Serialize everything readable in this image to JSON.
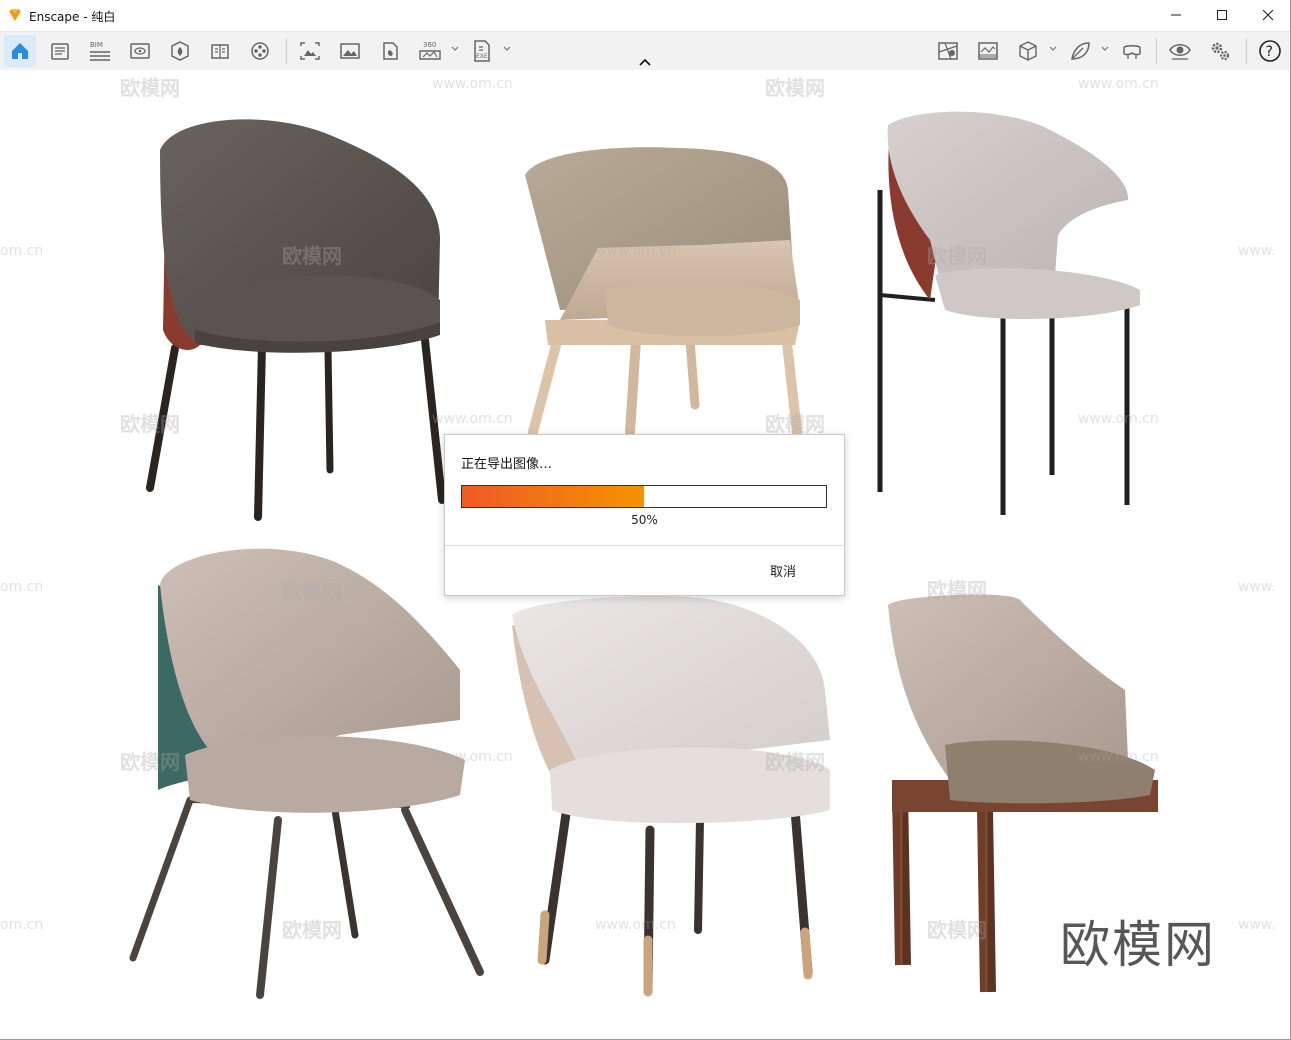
{
  "window": {
    "title": "Enscape - 纯白",
    "controls": [
      "minimize",
      "maximize",
      "close"
    ]
  },
  "toolbar": {
    "left_buttons": [
      {
        "icon": "home-icon",
        "active": true
      },
      {
        "icon": "document-icon"
      },
      {
        "icon": "bim-icon",
        "label": "BIM"
      },
      {
        "icon": "eye-view-icon"
      },
      {
        "icon": "asset-library-icon"
      },
      {
        "icon": "book-icon"
      },
      {
        "icon": "film-reel-icon"
      },
      {
        "icon": "screenshot-icon"
      },
      {
        "icon": "image-icon"
      },
      {
        "icon": "panorama-icon"
      },
      {
        "icon": "360-export-icon",
        "label": "360"
      },
      {
        "icon": "exe-export-icon",
        "label": "EXE"
      }
    ],
    "right_buttons": [
      {
        "icon": "map-icon"
      },
      {
        "icon": "image-grid-icon"
      },
      {
        "icon": "cube-icon"
      },
      {
        "icon": "leaf-icon"
      },
      {
        "icon": "vr-headset-icon"
      },
      {
        "icon": "eye-settings-icon"
      },
      {
        "icon": "gears-icon"
      },
      {
        "icon": "help-icon",
        "label": "?"
      }
    ]
  },
  "watermarks": {
    "logo_text": "欧模网",
    "url_text": "www.om.cn",
    "url_fragment": "om.cn",
    "url_fragment_right": "www."
  },
  "dialog": {
    "title": "正在导出图像…",
    "progress_percent": 50,
    "progress_label": "50%",
    "cancel_label": "取消",
    "fill_start_color": "#ef5a26",
    "fill_end_color": "#f59300"
  }
}
